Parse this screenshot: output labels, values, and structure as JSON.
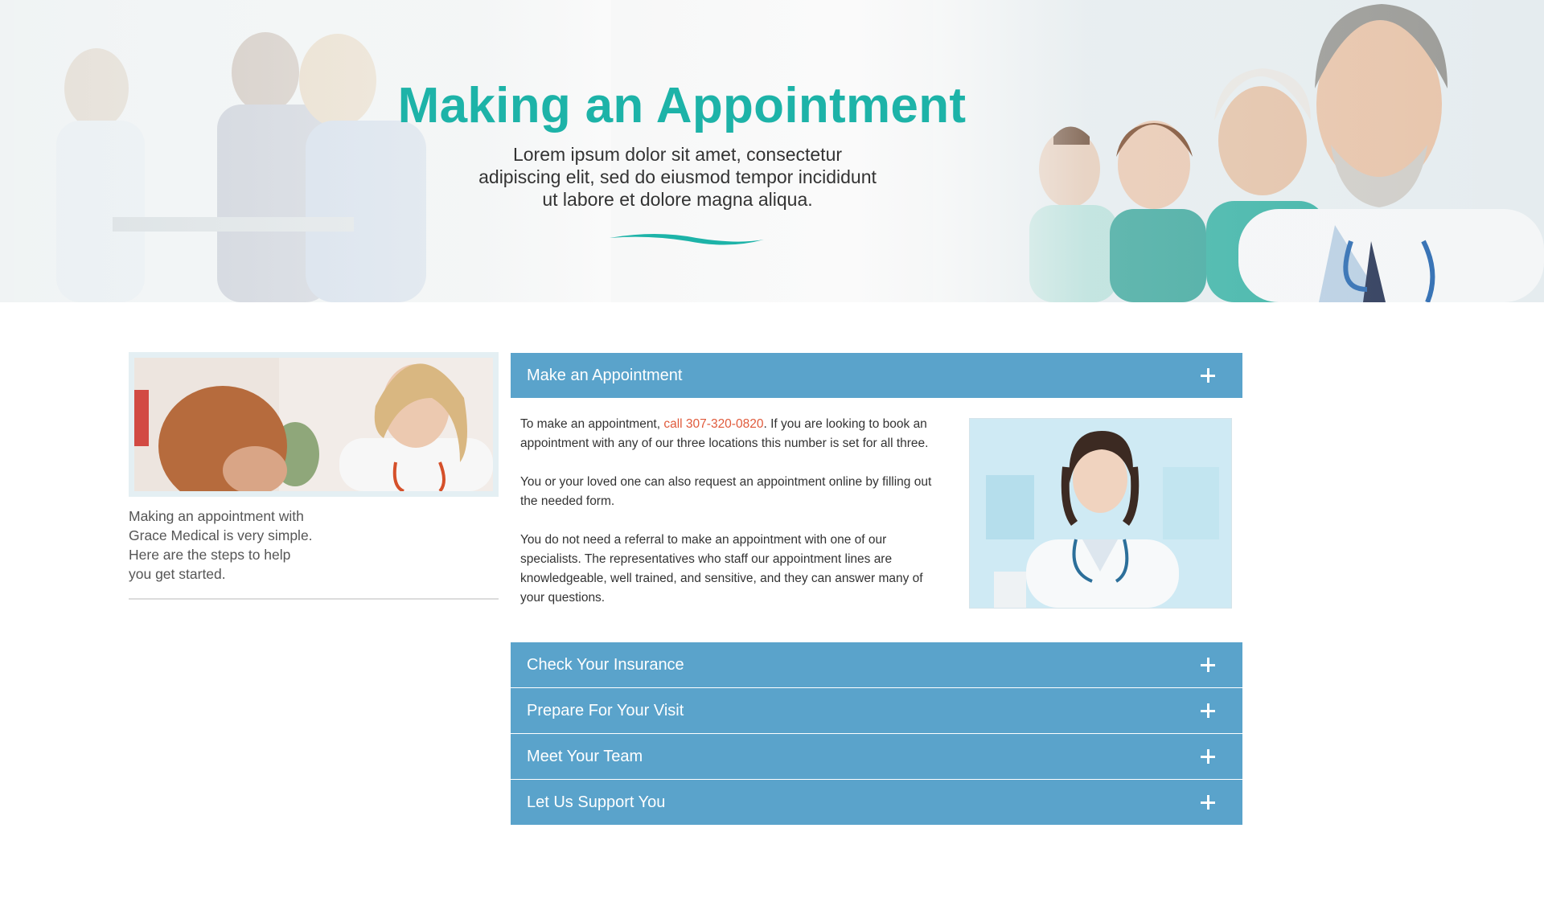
{
  "hero": {
    "title": "Making an Appointment",
    "subtitle_line1": "Lorem ipsum dolor sit amet, consectetur",
    "subtitle_line2": "adipiscing elit, sed do eiusmod tempor incididunt",
    "subtitle_line3": "ut labore et dolore magna aliqua.",
    "title_color": "#1db3a8"
  },
  "sidebar": {
    "intro_line1": "Making an appointment with",
    "intro_line2": "Grace Medical is very simple.",
    "intro_line3": "Here are the steps to help",
    "intro_line4": "you get started."
  },
  "accordion": {
    "header_color": "#5aa3cb",
    "sections": [
      {
        "label": "Make an Appointment",
        "expanded": true,
        "icon": "plus-icon"
      },
      {
        "label": "Check Your Insurance",
        "expanded": false,
        "icon": "plus-icon"
      },
      {
        "label": "Prepare For Your Visit",
        "expanded": false,
        "icon": "plus-icon"
      },
      {
        "label": "Meet Your Team",
        "expanded": false,
        "icon": "plus-icon"
      },
      {
        "label": "Let Us Support You",
        "expanded": false,
        "icon": "plus-icon"
      }
    ],
    "open_section": {
      "p1_before": "To make an appointment, ",
      "p1_link": "call 307-320-0820",
      "p1_after": ". If you are looking to book an appointment with any of our three locations this number is set for all three.",
      "p2": "You or your loved one can also request an appointment online by filling out the needed form.",
      "p3": "You do not need a referral to make an appointment with one of our specialists. The representatives who staff our appointment lines are knowledgeable, well trained, and sensitive, and they can answer many of your questions.",
      "link_color": "#e05a3b"
    }
  }
}
